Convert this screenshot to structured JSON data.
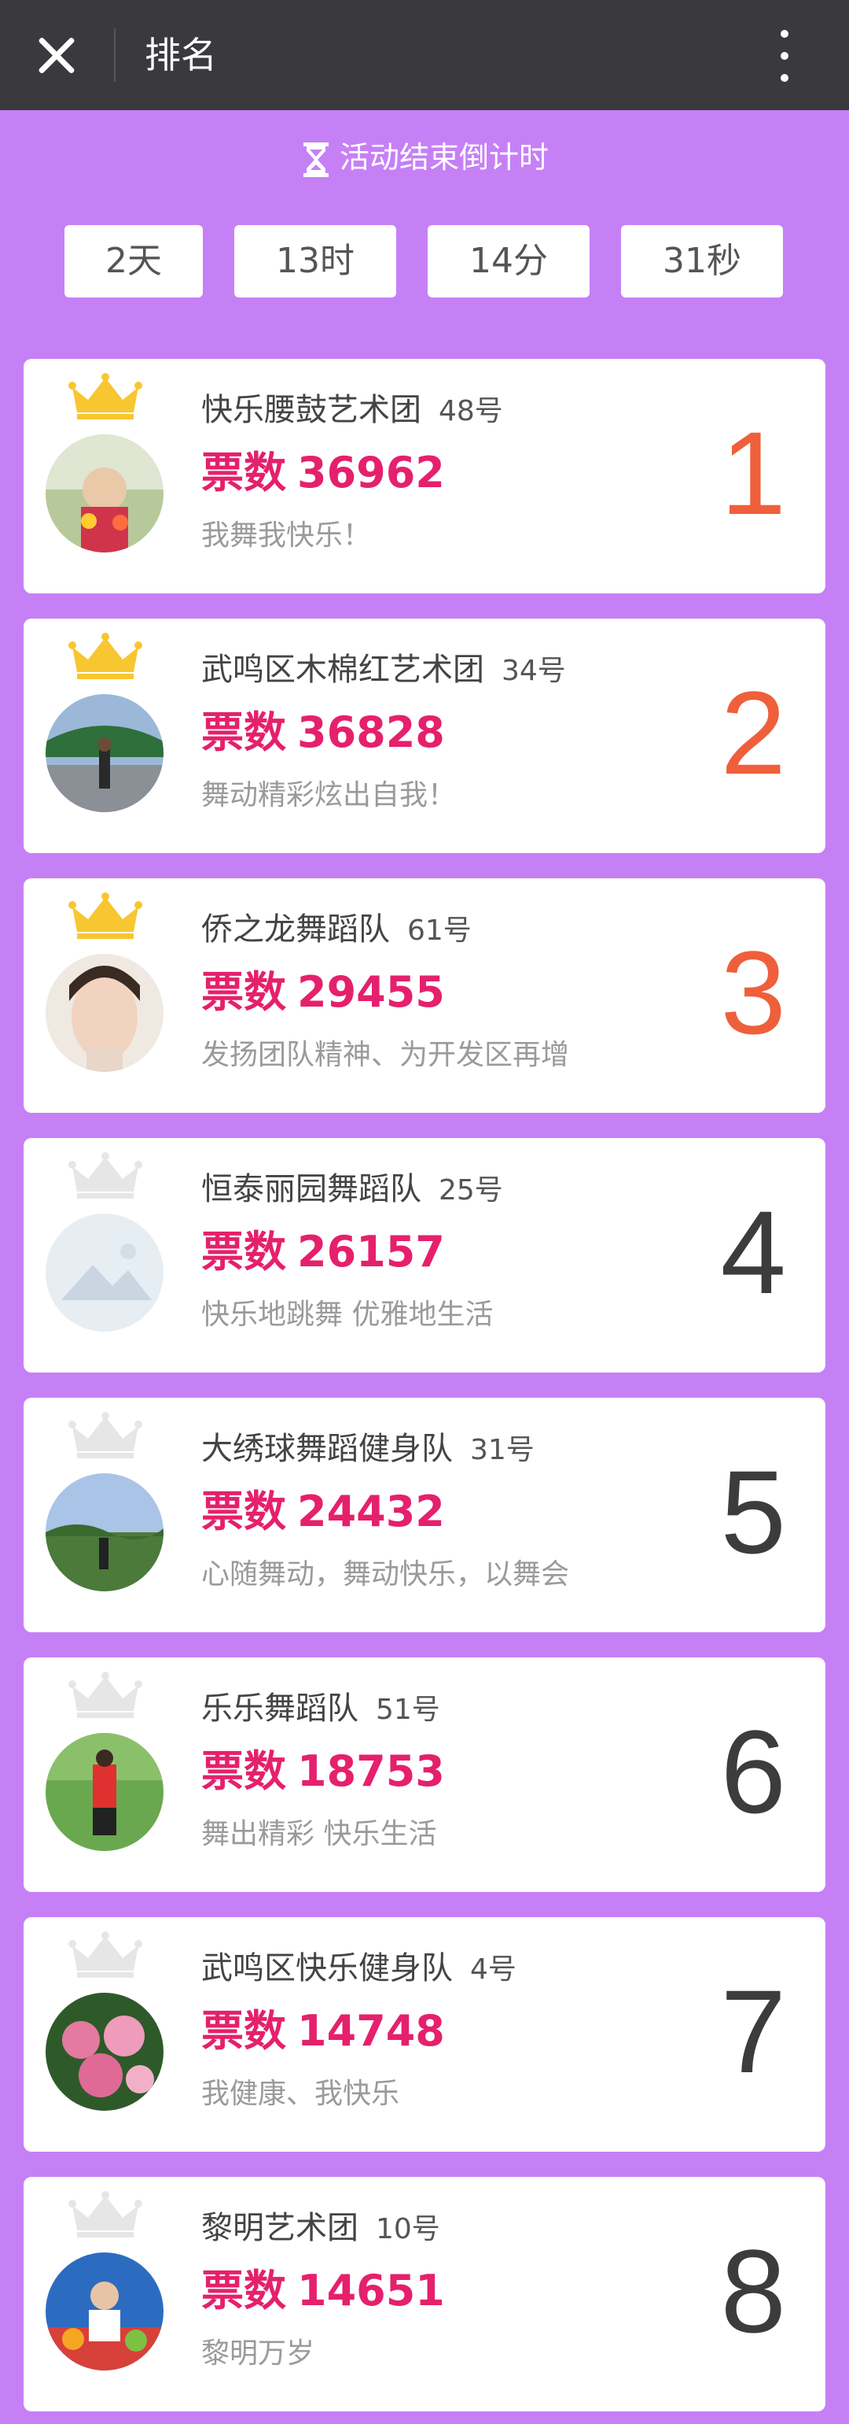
{
  "header": {
    "title": "排名",
    "close_icon": "close-icon",
    "more_icon": "more-vertical-icon"
  },
  "countdown": {
    "label": "活动结束倒计时",
    "icon": "hourglass-icon",
    "days": "2天",
    "hours": "13时",
    "minutes": "14分",
    "seconds": "31秒"
  },
  "colors": {
    "background": "#c680f6",
    "topbar": "#3a3a3e",
    "votes": "#e5206c",
    "top_rank": "#ef5f3b",
    "crown_gold": "#f8c630",
    "crown_grey": "#e6e6e6"
  },
  "votes_label": "票数",
  "ranking": [
    {
      "rank": "1",
      "name": "快乐腰鼓艺术团",
      "number": "48号",
      "votes": "36962",
      "slogan": "我舞我快乐！",
      "crown": "gold-crown-icon"
    },
    {
      "rank": "2",
      "name": "武鸣区木棉红艺术团",
      "number": "34号",
      "votes": "36828",
      "slogan": "舞动精彩炫出自我！",
      "crown": "gold-crown-icon"
    },
    {
      "rank": "3",
      "name": "侨之龙舞蹈队",
      "number": "61号",
      "votes": "29455",
      "slogan": "发扬团队精神、为开发区再增",
      "crown": "gold-crown-icon"
    },
    {
      "rank": "4",
      "name": "恒泰丽园舞蹈队",
      "number": "25号",
      "votes": "26157",
      "slogan": "快乐地跳舞 优雅地生活",
      "crown": "grey-crown-icon"
    },
    {
      "rank": "5",
      "name": "大绣球舞蹈健身队",
      "number": "31号",
      "votes": "24432",
      "slogan": "心随舞动，舞动快乐，以舞会",
      "crown": "grey-crown-icon"
    },
    {
      "rank": "6",
      "name": "乐乐舞蹈队",
      "number": "51号",
      "votes": "18753",
      "slogan": "舞出精彩 快乐生活",
      "crown": "grey-crown-icon"
    },
    {
      "rank": "7",
      "name": "武鸣区快乐健身队",
      "number": "4号",
      "votes": "14748",
      "slogan": "我健康、我快乐",
      "crown": "grey-crown-icon"
    },
    {
      "rank": "8",
      "name": "黎明艺术团",
      "number": "10号",
      "votes": "14651",
      "slogan": "黎明万岁",
      "crown": "grey-crown-icon"
    }
  ]
}
